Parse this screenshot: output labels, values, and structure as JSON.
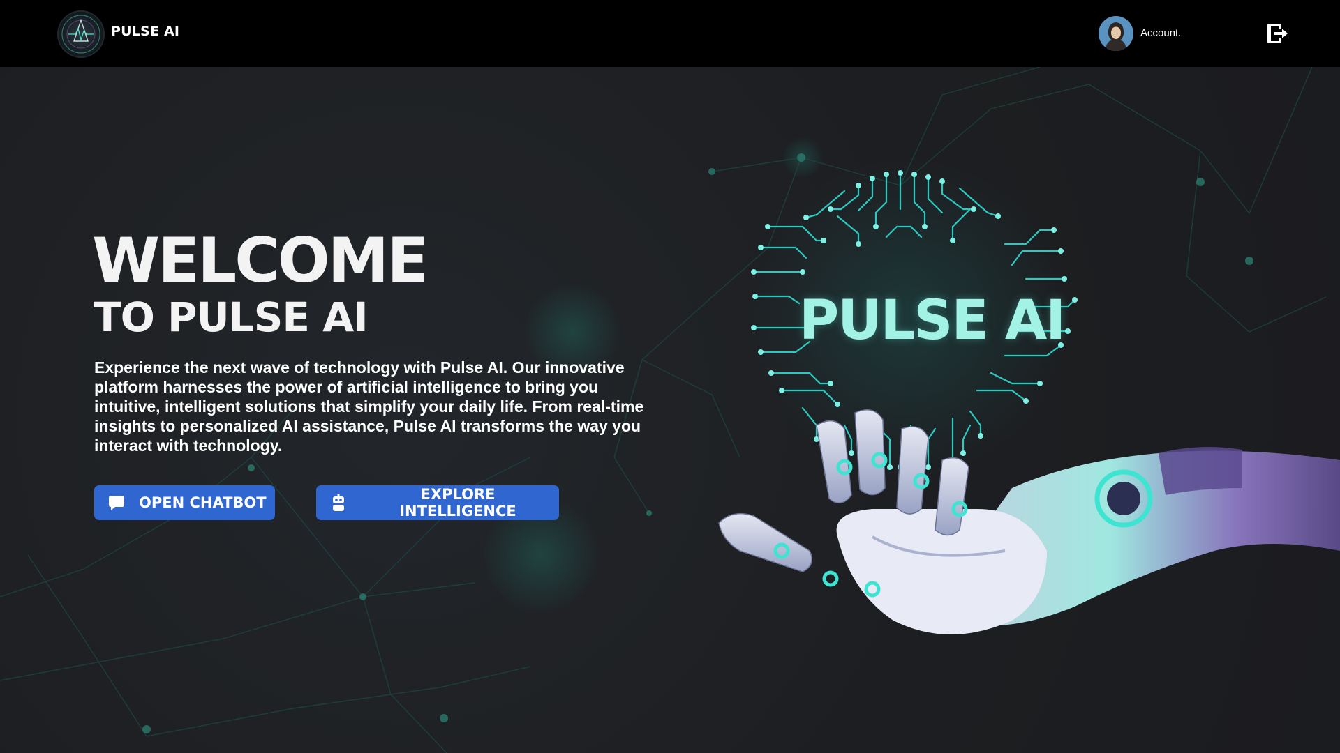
{
  "header": {
    "brand": "PULSE AI",
    "account_label": "Account."
  },
  "hero": {
    "title": "WELCOME",
    "subtitle": "TO  PULSE AI",
    "description": "Experience the next wave of technology with Pulse AI. Our innovative platform harnesses the power of artificial intelligence to bring you intuitive, intelligent solutions that simplify your daily life. From real-time insights to personalized AI assistance, Pulse AI transforms the way you interact with technology.",
    "buttons": [
      {
        "label": "OPEN CHATBOT",
        "icon": "chat-bubble-icon"
      },
      {
        "label": "EXPLORE INTELLIGENCE",
        "icon": "robot-icon"
      }
    ]
  },
  "illustration": {
    "title": "PULSE AI"
  },
  "colors": {
    "topbar": "#000000",
    "background": "#1d1e21",
    "button": "#2f66d0",
    "accent": "#a3f2e6",
    "network": "#1f5a52"
  },
  "icons": {
    "logo": "pulse-logo-icon",
    "avatar": "user-avatar-icon",
    "logout": "logout-icon"
  }
}
